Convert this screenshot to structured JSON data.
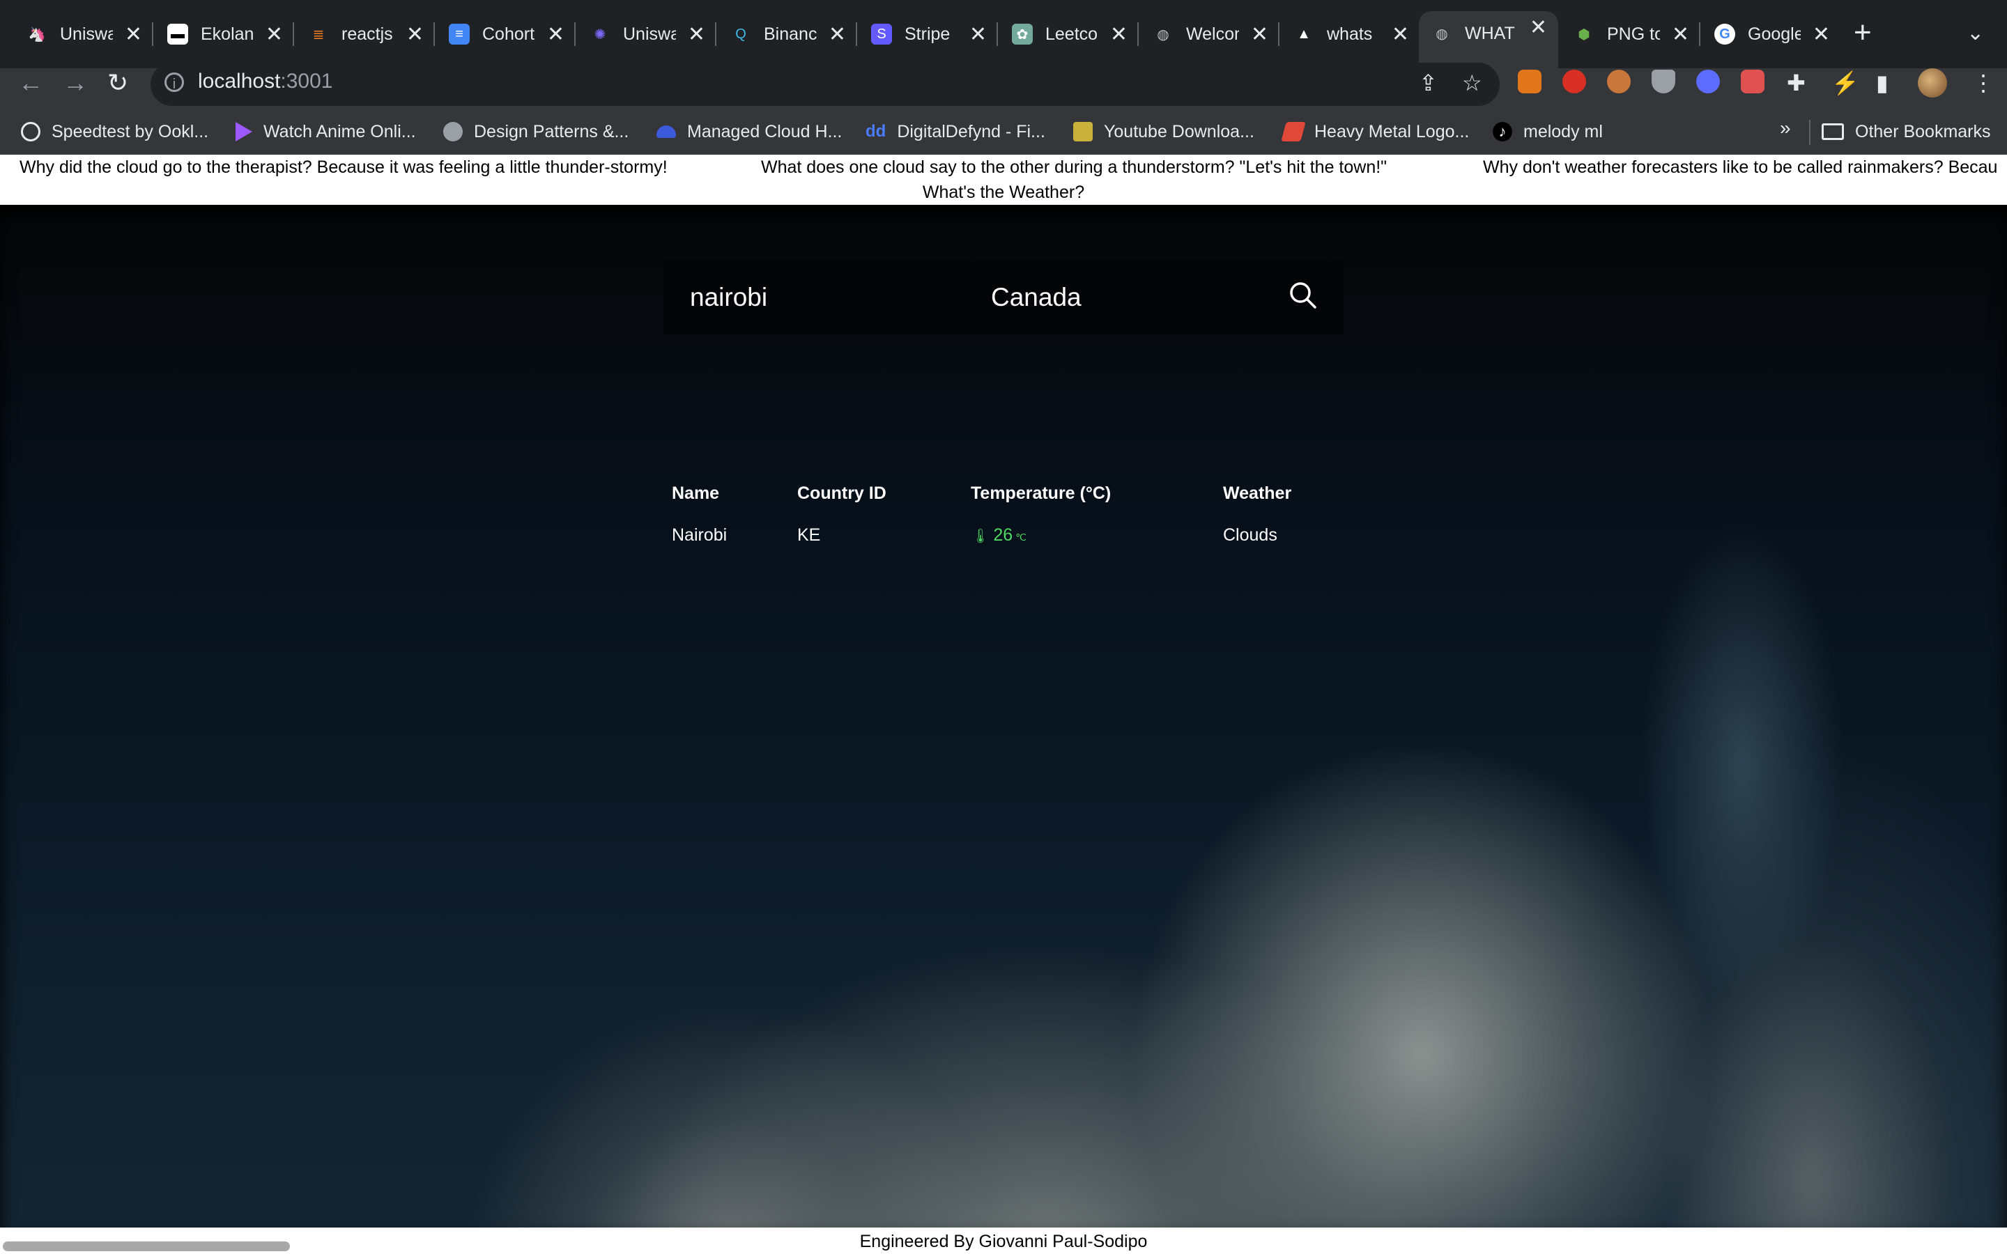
{
  "browser": {
    "tabs": [
      {
        "title": "Uniswap"
      },
      {
        "title": "Ekolance"
      },
      {
        "title": "reactjs"
      },
      {
        "title": "Cohort"
      },
      {
        "title": "Uniswap"
      },
      {
        "title": "Binance"
      },
      {
        "title": "Stripe"
      },
      {
        "title": "Leetcode"
      },
      {
        "title": "Welcome"
      },
      {
        "title": "whats"
      },
      {
        "title": "WHAT"
      },
      {
        "title": "PNG to"
      },
      {
        "title": "Google"
      }
    ],
    "address": {
      "host": "localhost",
      "port": ":3001"
    },
    "bookmarks": [
      "Speedtest by Ookl...",
      "Watch Anime Onli...",
      "Design Patterns &...",
      "Managed Cloud H...",
      "DigitalDefynd - Fi...",
      "Youtube Downloa...",
      "Heavy Metal Logo...",
      "melody ml"
    ],
    "bookmarks_more": "»",
    "other_bookmarks": "Other Bookmarks"
  },
  "page": {
    "jokes": [
      "Why did the cloud go to the therapist? Because it was feeling a little thunder-stormy!",
      "What does one cloud say to the other during a thunderstorm? \"Let's hit the town!\"",
      "Why don't weather forecasters like to be called rainmakers? Becau"
    ],
    "title": "What's the Weather?",
    "search": {
      "city": "nairobi",
      "country": "Canada"
    },
    "table": {
      "headers": [
        "Name",
        "Country ID",
        "Temperature (°C)",
        "Weather"
      ],
      "rows": [
        {
          "name": "Nairobi",
          "country_id": "KE",
          "temperature": "26",
          "weather": "Clouds"
        }
      ]
    },
    "footer": "Engineered By Giovanni Paul-Sodipo"
  },
  "colors": {
    "temperature": "#4cd964",
    "tab_bg": "#202124",
    "toolbar_bg": "#35363a"
  },
  "icons": {
    "search": "magnifier",
    "thermometer": "thermometer",
    "unit": "celsius"
  }
}
